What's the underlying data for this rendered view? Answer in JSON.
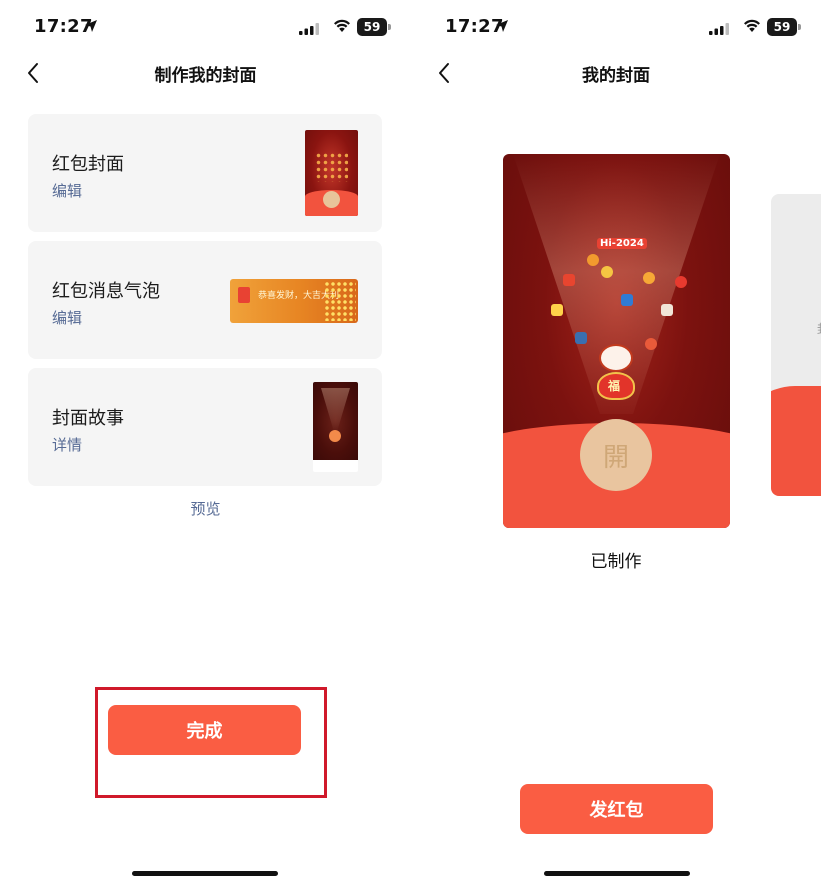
{
  "left_screen": {
    "status_bar": {
      "time": "17:27",
      "battery": "59"
    },
    "nav": {
      "title": "制作我的封面"
    },
    "cards": [
      {
        "title": "红包封面",
        "action": "编辑"
      },
      {
        "title": "红包消息气泡",
        "action": "编辑"
      },
      {
        "title": "封面故事",
        "action": "详情"
      }
    ],
    "bubble_thumb": {
      "text": "恭喜发财，大吉大利"
    },
    "preview_link": "预览",
    "done_button": "完成"
  },
  "right_screen": {
    "status_bar": {
      "time": "17:27",
      "battery": "59"
    },
    "nav": {
      "title": "我的封面"
    },
    "cover": {
      "seal_char": "開",
      "badge": "Hi-2024",
      "dragon_char": "福"
    },
    "status_label": "已制作",
    "send_button": "发红包",
    "next_card_peek": "封"
  },
  "colors": {
    "accent": "#fa5d43",
    "link": "#576b95",
    "highlight_box": "#d0192a",
    "card_bg": "#f5f5f5"
  },
  "icons": [
    "location-arrow-icon",
    "cellular-signal-icon",
    "wifi-icon",
    "battery-icon",
    "back-chevron-icon"
  ]
}
